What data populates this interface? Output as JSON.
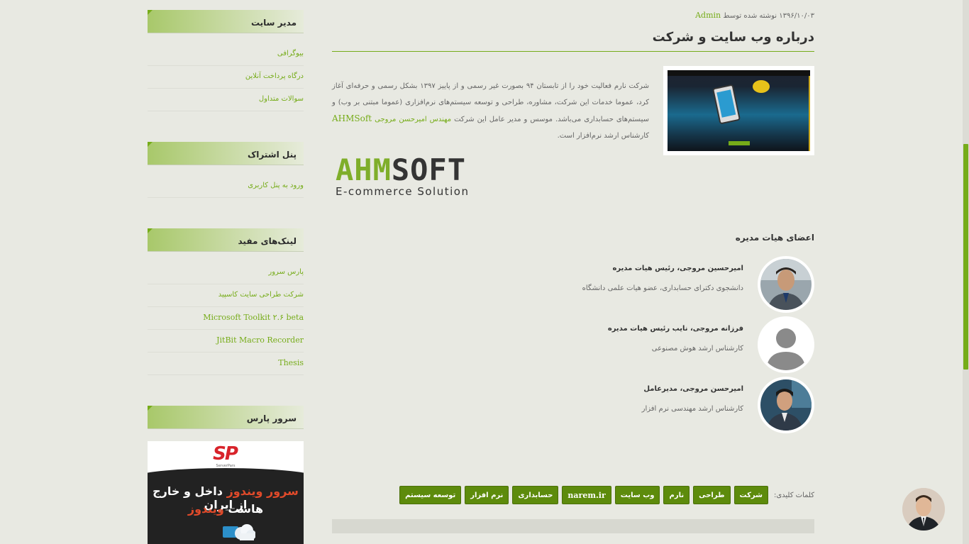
{
  "sidebar": {
    "site_manager": {
      "title": "مدیر سایت",
      "items": [
        "بیوگرافی",
        "درگاه پرداخت آنلاین",
        "سوالات متداول"
      ]
    },
    "subscription": {
      "title": "پنل اشتراک",
      "items": [
        "ورود به پنل کاربری"
      ]
    },
    "useful_links": {
      "title": "لینک‌های مفید",
      "items": [
        "پارس سرور",
        "شرکت طراحی سایت کاسپید",
        "Microsoft Toolkit ۲.۶ beta",
        "JitBit Macro Recorder",
        "Thesis"
      ]
    },
    "pars_server": {
      "title": "سرور پارس",
      "banner": {
        "logo": "SP",
        "logo_sub": "ServerPars",
        "line1_red": "سرور ویندوز",
        "line1_white": "داخل و خارج از ایران",
        "line2_white": "هاست",
        "line2_red": "ویندوز"
      }
    }
  },
  "post": {
    "date": "۱۳۹۶/۱۰/۰۳",
    "written_by": "نوشته شده توسط",
    "author": "Admin",
    "title": "درباره وب سایت و شرکت",
    "text_part1": "شرکت نارم فعالیت خود را از تابستان ۹۴ بصورت غیر رسمی و از پاییز ۱۳۹۷ بشکل رسمی و حرفه‌ای آغاز کرد، عموما خدمات این شرکت، مشاوره، طراحی و توسعه سیستم‌های نرم‌افزاری (عموما مبتنی بر وب) و سیستم‌های حسابداری می‌باشد. موسس و مدیر عامل این شرکت",
    "text_engineer": "مهندس امیرحسن مروجی",
    "text_brand": "AHMSoft",
    "text_part2": "کارشناس ارشد نرم‌افزار است.",
    "logo_left": "AHM",
    "logo_right": "SOFT",
    "logo_tagline": "E-commerce Solution"
  },
  "board": {
    "title": "اعضای هیات مدیره",
    "members": [
      {
        "name": "امیرحسین مروجی، رئیس هیات مدیره",
        "desc": "دانشجوی دکترای حسابداری، عضو هیات علمی دانشگاه"
      },
      {
        "name": "فرزانه مروجی، نایب رئیس هیات مدیره",
        "desc": "کارشناس ارشد هوش مصنوعی"
      },
      {
        "name": "امیرحسن مروجی، مدیرعامل",
        "desc": "کارشناس ارشد مهندسی نرم افزار"
      }
    ]
  },
  "tags": {
    "label": "کلمات کلیدی:",
    "items": [
      "شرکت",
      "طراحی",
      "نارم",
      "وب سایت",
      "narem.ir",
      "حسابداری",
      "نرم افزار",
      "توسعه سیستم"
    ]
  },
  "colors": {
    "accent": "#76ac19",
    "tag_bg": "#5d8b0c",
    "page_bg": "#e8e9e2"
  }
}
